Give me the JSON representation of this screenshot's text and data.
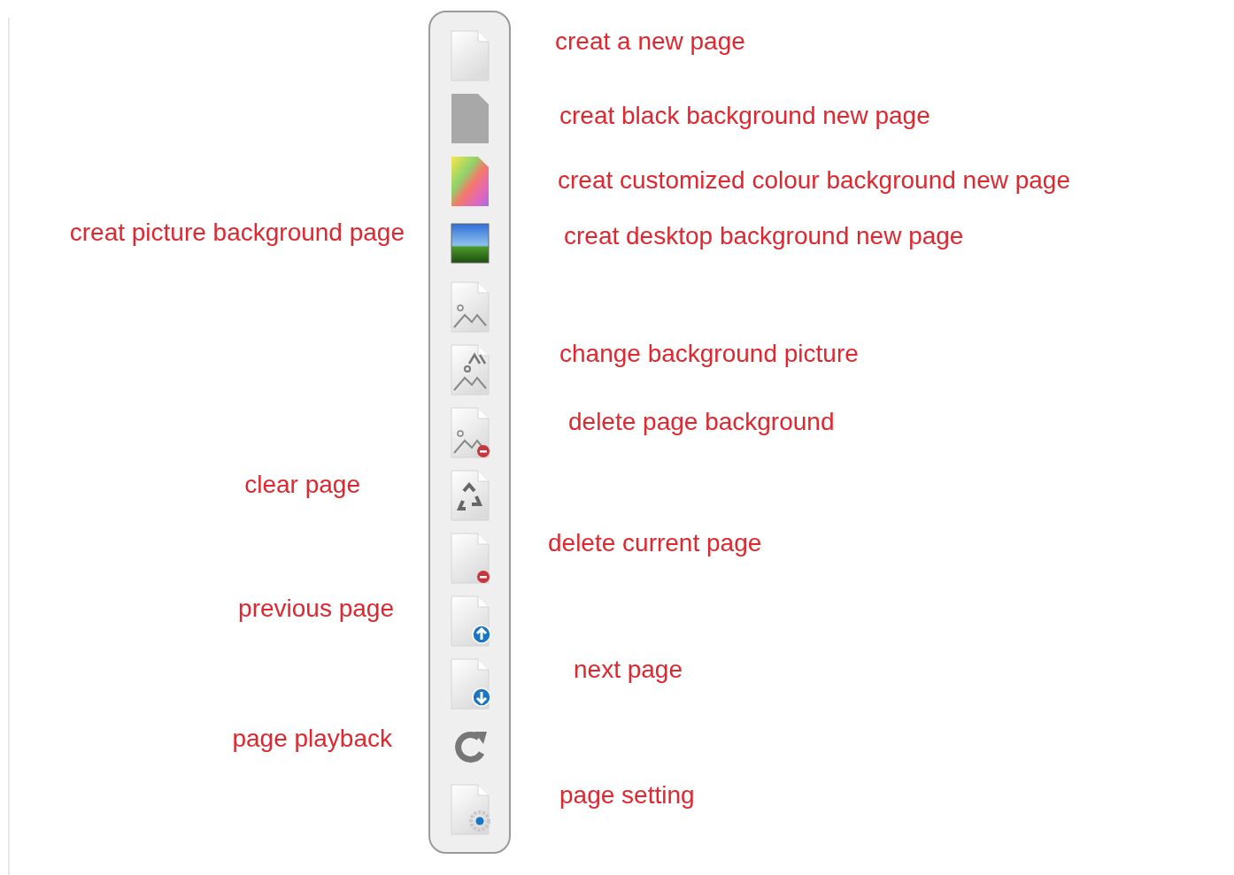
{
  "toolbar": {
    "tools": [
      {
        "kind": "blank-page"
      },
      {
        "kind": "gray-page"
      },
      {
        "kind": "gradient-page"
      },
      {
        "kind": "landscape"
      },
      {
        "kind": "image-page"
      },
      {
        "kind": "image-swap"
      },
      {
        "kind": "image-delete"
      },
      {
        "kind": "recycle"
      },
      {
        "kind": "page-delete"
      },
      {
        "kind": "page-up"
      },
      {
        "kind": "page-down"
      },
      {
        "kind": "refresh"
      },
      {
        "kind": "page-settings"
      }
    ]
  },
  "left_labels": [
    "creat picture background page",
    "clear page",
    "previous page",
    "page playback"
  ],
  "right_labels": [
    "creat a new page",
    "creat black background new page",
    "creat customized colour background new page",
    "creat desktop background new page",
    "change background picture",
    "delete page background",
    "delete current page",
    "next page",
    "page setting"
  ]
}
